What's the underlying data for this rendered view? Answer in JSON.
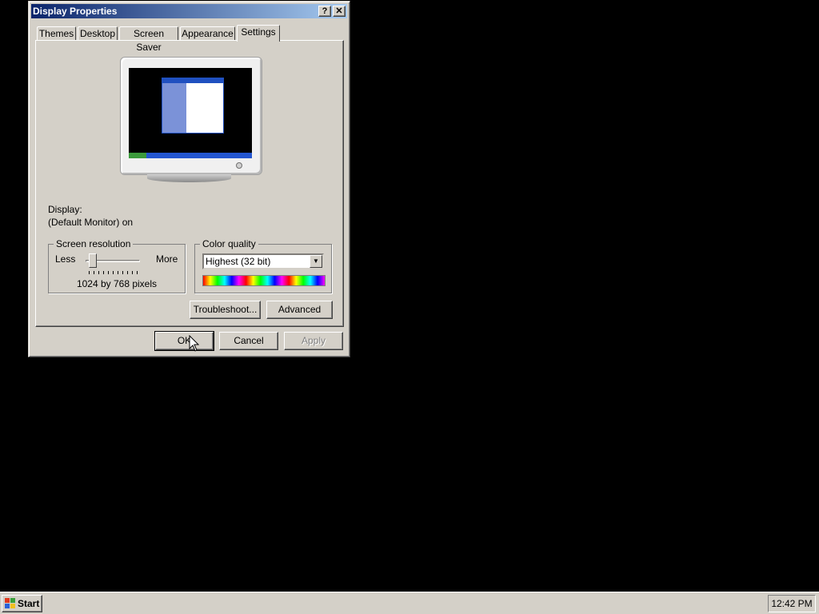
{
  "window": {
    "title": "Display Properties",
    "help_button": "?",
    "close_button": "✕"
  },
  "tabs": [
    "Themes",
    "Desktop",
    "Screen Saver",
    "Appearance",
    "Settings"
  ],
  "active_tab": "Settings",
  "display": {
    "label": "Display:",
    "value": "(Default Monitor) on"
  },
  "resolution": {
    "legend": "Screen resolution",
    "less": "Less",
    "more": "More",
    "value_text": "1024 by 768 pixels"
  },
  "color_quality": {
    "legend": "Color quality",
    "selected": "Highest (32 bit)"
  },
  "buttons": {
    "troubleshoot": "Troubleshoot...",
    "advanced": "Advanced",
    "ok": "OK",
    "cancel": "Cancel",
    "apply": "Apply"
  },
  "taskbar": {
    "start": "Start",
    "clock": "12:42 PM"
  },
  "colors": {
    "desktop": "#000000",
    "dialog": "#d4d0c8",
    "titlebar_start": "#0a246a",
    "titlebar_end": "#a6caf0"
  }
}
